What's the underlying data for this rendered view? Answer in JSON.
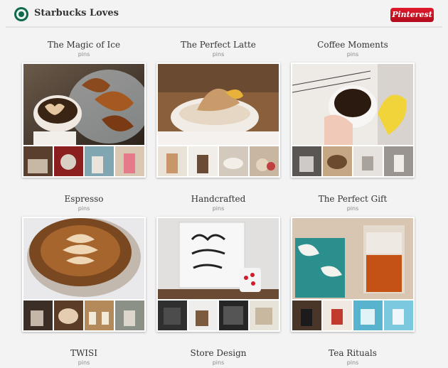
{
  "header": {
    "brand": "Starbucks Loves",
    "pinterest_label": "Pinterest",
    "logo_icon": "starbucks-siren-icon"
  },
  "boards": [
    {
      "title": "The Magic of Ice",
      "sub": "pins"
    },
    {
      "title": "The Perfect Latte",
      "sub": "pins"
    },
    {
      "title": "Coffee Moments",
      "sub": "pins"
    },
    {
      "title": "Espresso",
      "sub": "pins"
    },
    {
      "title": "Handcrafted",
      "sub": "pins"
    },
    {
      "title": "The Perfect Gift",
      "sub": "pins"
    },
    {
      "title": "TWISI",
      "sub": "pins"
    },
    {
      "title": "Store Design",
      "sub": "pins"
    },
    {
      "title": "Tea Rituals",
      "sub": "pins"
    }
  ],
  "colors": {
    "pinterest_red": "#cb2027",
    "background": "#f4f3f3"
  }
}
